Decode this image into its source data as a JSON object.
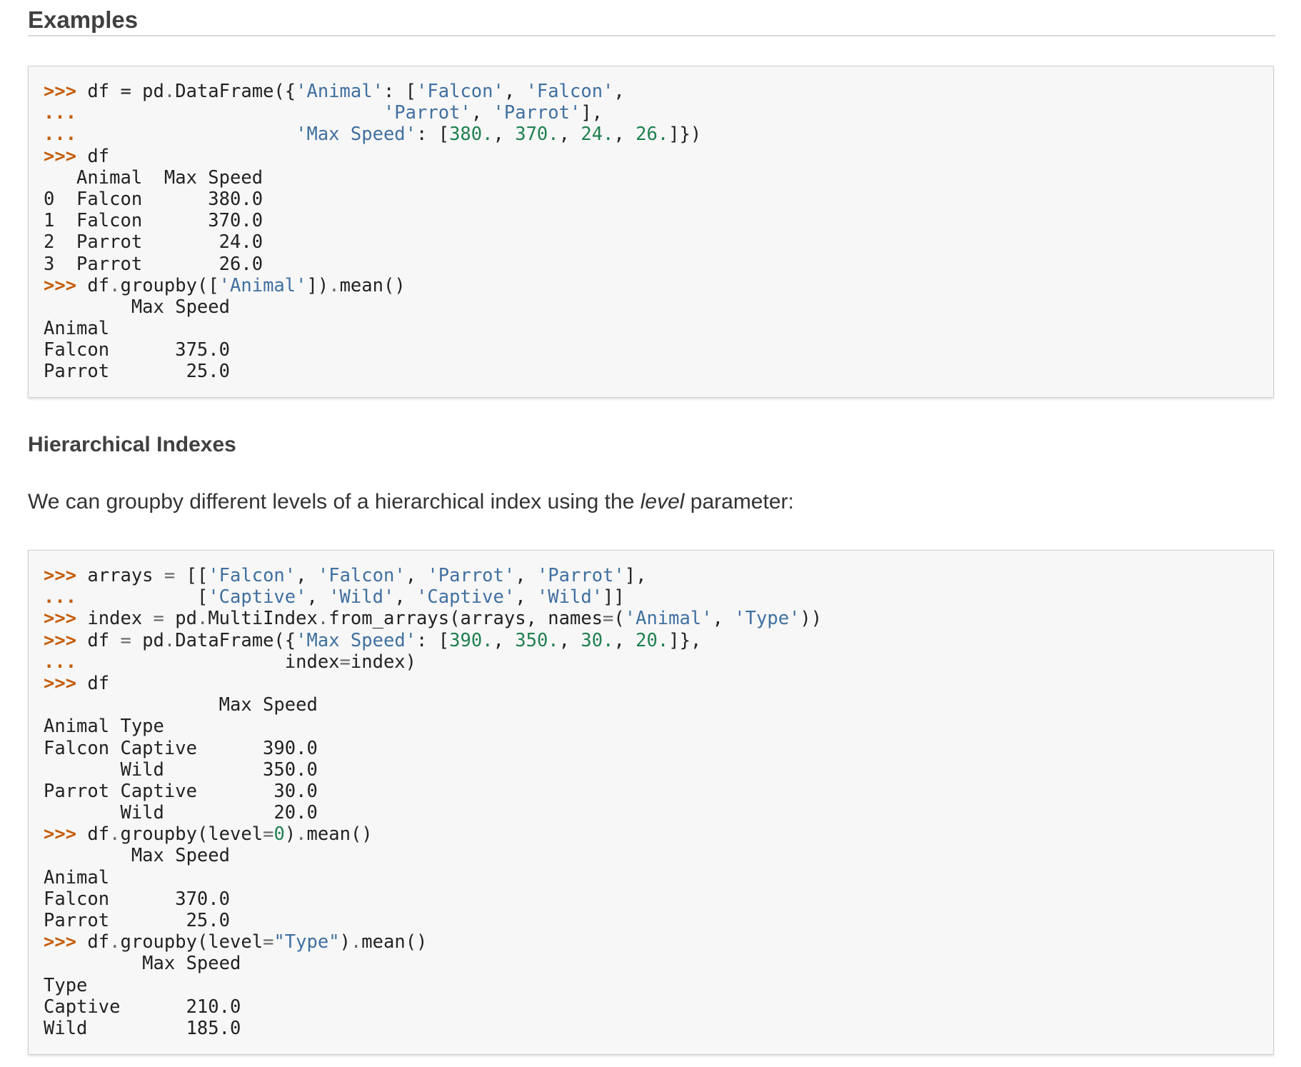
{
  "examples_heading": "Examples",
  "hierarchical_heading": "Hierarchical Indexes",
  "paragraph": {
    "before": "We can groupby different levels of a hierarchical index using the ",
    "emphasis": "level",
    "after": " parameter:"
  },
  "code_block_1": [
    [
      [
        "p",
        ">>> "
      ],
      [
        "t",
        "df = pd"
      ],
      [
        "o",
        "."
      ],
      [
        "t",
        "DataFrame({"
      ],
      [
        "s",
        "'Animal'"
      ],
      [
        "t",
        ": ["
      ],
      [
        "s",
        "'Falcon'"
      ],
      [
        "t",
        ", "
      ],
      [
        "s",
        "'Falcon'"
      ],
      [
        "t",
        ","
      ]
    ],
    [
      [
        "p",
        "... "
      ],
      [
        "t",
        "                           "
      ],
      [
        "s",
        "'Parrot'"
      ],
      [
        "t",
        ", "
      ],
      [
        "s",
        "'Parrot'"
      ],
      [
        "t",
        "],"
      ]
    ],
    [
      [
        "p",
        "... "
      ],
      [
        "t",
        "                   "
      ],
      [
        "s",
        "'Max Speed'"
      ],
      [
        "t",
        ": ["
      ],
      [
        "n",
        "380."
      ],
      [
        "t",
        ", "
      ],
      [
        "n",
        "370."
      ],
      [
        "t",
        ", "
      ],
      [
        "n",
        "24."
      ],
      [
        "t",
        ", "
      ],
      [
        "n",
        "26."
      ],
      [
        "t",
        "]})"
      ]
    ],
    [
      [
        "p",
        ">>> "
      ],
      [
        "t",
        "df"
      ]
    ],
    [
      [
        "t",
        "   Animal  Max Speed"
      ]
    ],
    [
      [
        "t",
        "0  Falcon      380.0"
      ]
    ],
    [
      [
        "t",
        "1  Falcon      370.0"
      ]
    ],
    [
      [
        "t",
        "2  Parrot       24.0"
      ]
    ],
    [
      [
        "t",
        "3  Parrot       26.0"
      ]
    ],
    [
      [
        "p",
        ">>> "
      ],
      [
        "t",
        "df"
      ],
      [
        "o",
        "."
      ],
      [
        "t",
        "groupby(["
      ],
      [
        "s",
        "'Animal'"
      ],
      [
        "t",
        "])"
      ],
      [
        "o",
        "."
      ],
      [
        "t",
        "mean()"
      ]
    ],
    [
      [
        "t",
        "        Max Speed"
      ]
    ],
    [
      [
        "t",
        "Animal"
      ]
    ],
    [
      [
        "t",
        "Falcon      375.0"
      ]
    ],
    [
      [
        "t",
        "Parrot       25.0"
      ]
    ]
  ],
  "code_block_2": [
    [
      [
        "p",
        ">>> "
      ],
      [
        "t",
        "arrays "
      ],
      [
        "o",
        "="
      ],
      [
        "t",
        " [["
      ],
      [
        "s",
        "'Falcon'"
      ],
      [
        "t",
        ", "
      ],
      [
        "s",
        "'Falcon'"
      ],
      [
        "t",
        ", "
      ],
      [
        "s",
        "'Parrot'"
      ],
      [
        "t",
        ", "
      ],
      [
        "s",
        "'Parrot'"
      ],
      [
        "t",
        "],"
      ]
    ],
    [
      [
        "p",
        "... "
      ],
      [
        "t",
        "          ["
      ],
      [
        "s",
        "'Captive'"
      ],
      [
        "t",
        ", "
      ],
      [
        "s",
        "'Wild'"
      ],
      [
        "t",
        ", "
      ],
      [
        "s",
        "'Captive'"
      ],
      [
        "t",
        ", "
      ],
      [
        "s",
        "'Wild'"
      ],
      [
        "t",
        "]]"
      ]
    ],
    [
      [
        "p",
        ">>> "
      ],
      [
        "t",
        "index "
      ],
      [
        "o",
        "="
      ],
      [
        "t",
        " pd"
      ],
      [
        "o",
        "."
      ],
      [
        "t",
        "MultiIndex"
      ],
      [
        "o",
        "."
      ],
      [
        "t",
        "from_arrays(arrays, names"
      ],
      [
        "o",
        "="
      ],
      [
        "t",
        "("
      ],
      [
        "s",
        "'Animal'"
      ],
      [
        "t",
        ", "
      ],
      [
        "s",
        "'Type'"
      ],
      [
        "t",
        "))"
      ]
    ],
    [
      [
        "p",
        ">>> "
      ],
      [
        "t",
        "df "
      ],
      [
        "o",
        "="
      ],
      [
        "t",
        " pd"
      ],
      [
        "o",
        "."
      ],
      [
        "t",
        "DataFrame({"
      ],
      [
        "s",
        "'Max Speed'"
      ],
      [
        "t",
        ": ["
      ],
      [
        "n",
        "390."
      ],
      [
        "t",
        ", "
      ],
      [
        "n",
        "350."
      ],
      [
        "t",
        ", "
      ],
      [
        "n",
        "30."
      ],
      [
        "t",
        ", "
      ],
      [
        "n",
        "20."
      ],
      [
        "t",
        "]},"
      ]
    ],
    [
      [
        "p",
        "... "
      ],
      [
        "t",
        "                  index"
      ],
      [
        "o",
        "="
      ],
      [
        "t",
        "index)"
      ]
    ],
    [
      [
        "p",
        ">>> "
      ],
      [
        "t",
        "df"
      ]
    ],
    [
      [
        "t",
        "                Max Speed"
      ]
    ],
    [
      [
        "t",
        "Animal Type"
      ]
    ],
    [
      [
        "t",
        "Falcon Captive      390.0"
      ]
    ],
    [
      [
        "t",
        "       Wild         350.0"
      ]
    ],
    [
      [
        "t",
        "Parrot Captive       30.0"
      ]
    ],
    [
      [
        "t",
        "       Wild          20.0"
      ]
    ],
    [
      [
        "p",
        ">>> "
      ],
      [
        "t",
        "df"
      ],
      [
        "o",
        "."
      ],
      [
        "t",
        "groupby(level"
      ],
      [
        "o",
        "="
      ],
      [
        "n",
        "0"
      ],
      [
        "t",
        ")"
      ],
      [
        "o",
        "."
      ],
      [
        "t",
        "mean()"
      ]
    ],
    [
      [
        "t",
        "        Max Speed"
      ]
    ],
    [
      [
        "t",
        "Animal"
      ]
    ],
    [
      [
        "t",
        "Falcon      370.0"
      ]
    ],
    [
      [
        "t",
        "Parrot       25.0"
      ]
    ],
    [
      [
        "p",
        ">>> "
      ],
      [
        "t",
        "df"
      ],
      [
        "o",
        "."
      ],
      [
        "t",
        "groupby(level"
      ],
      [
        "o",
        "="
      ],
      [
        "s",
        "\"Type\""
      ],
      [
        "t",
        ")"
      ],
      [
        "o",
        "."
      ],
      [
        "t",
        "mean()"
      ]
    ],
    [
      [
        "t",
        "         Max Speed"
      ]
    ],
    [
      [
        "t",
        "Type"
      ]
    ],
    [
      [
        "t",
        "Captive      210.0"
      ]
    ],
    [
      [
        "t",
        "Wild         185.0"
      ]
    ]
  ],
  "colors": {
    "prompt": "#c65d09",
    "string": "#4070a0",
    "number": "#208050",
    "operator": "#666666",
    "code_background": "#f7f7f7"
  }
}
